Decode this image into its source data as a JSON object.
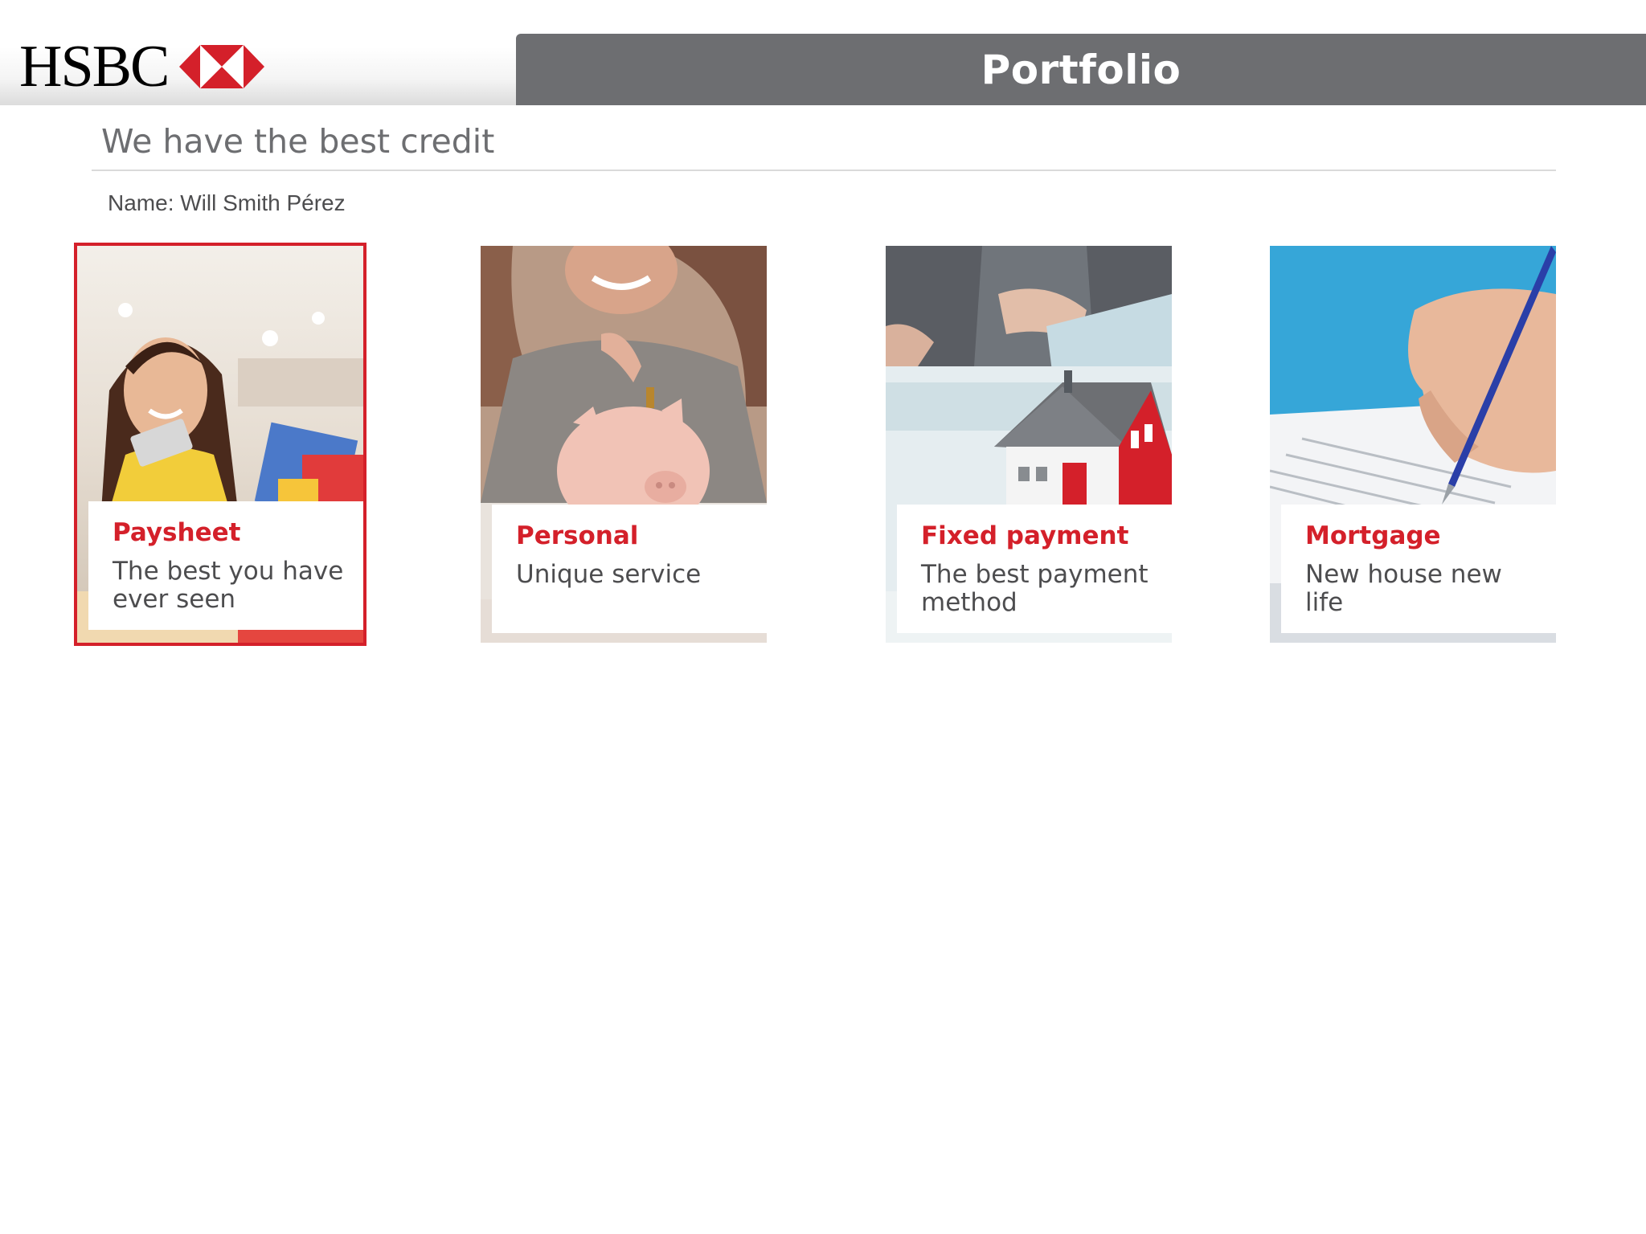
{
  "brand": {
    "name": "HSBC",
    "colors": {
      "accent": "#d4202a",
      "title_bar": "#6d6e71",
      "text": "#4d4d4f"
    }
  },
  "header": {
    "title": "Portfolio"
  },
  "tagline": "We have the best credit",
  "client": {
    "name_line": "Name: Will Smith Pérez"
  },
  "cards": [
    {
      "title": "Paysheet",
      "description": "The best you have ever seen",
      "image": "woman-shopping-photo",
      "selected": true
    },
    {
      "title": "Personal",
      "description": "Unique service",
      "image": "piggy-bank-photo",
      "selected": false
    },
    {
      "title": "Fixed payment",
      "description": "The best payment method",
      "image": "house-model-photo",
      "selected": false
    },
    {
      "title": "Mortgage",
      "description": "New house new life",
      "image": "signing-document-photo",
      "selected": false
    }
  ]
}
